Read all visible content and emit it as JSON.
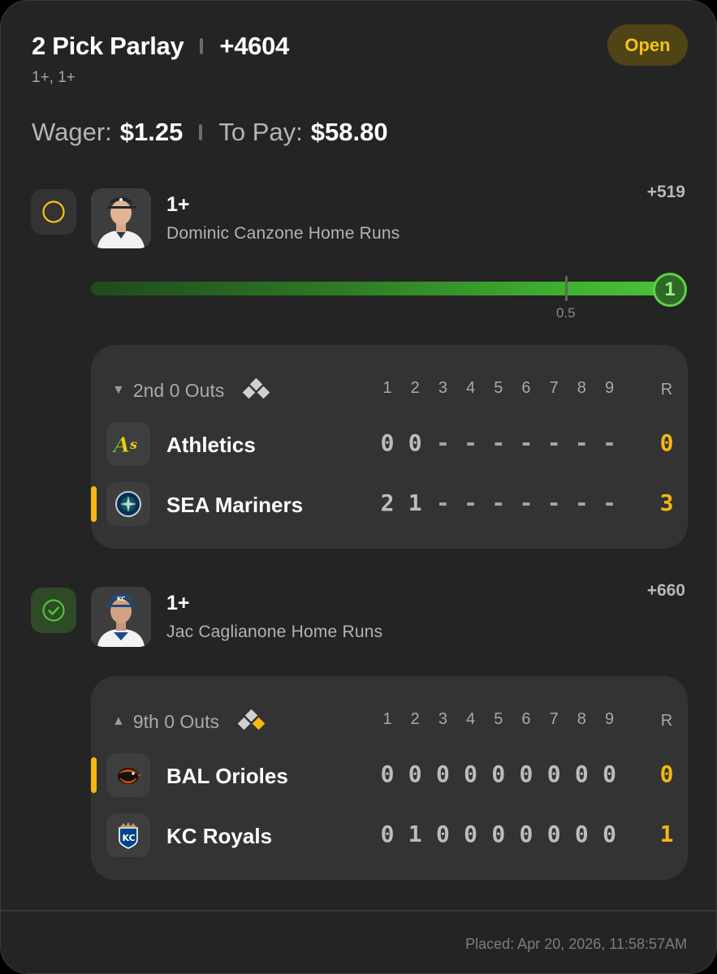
{
  "header": {
    "title": "2 Pick Parlay",
    "odds": "+4604",
    "subtitle": "1+, 1+",
    "status": "Open"
  },
  "wager": {
    "wager_label": "Wager:",
    "wager_value": "$1.25",
    "pay_label": "To Pay:",
    "pay_value": "$58.80"
  },
  "legs": [
    {
      "line": "1+",
      "desc": "Dominic Canzone Home Runs",
      "odds": "+519",
      "state": "open",
      "progress": {
        "current": "1",
        "threshold": "0.5",
        "fraction": 1.0
      },
      "game": {
        "inning": "2nd 0 Outs",
        "inning_arrow": "▼",
        "innings": [
          "1",
          "2",
          "3",
          "4",
          "5",
          "6",
          "7",
          "8",
          "9"
        ],
        "runs_header": "R",
        "teams": [
          {
            "name": "Athletics",
            "scores": [
              "0",
              "0",
              "-",
              "-",
              "-",
              "-",
              "-",
              "-",
              "-"
            ],
            "runs": "0",
            "batting": false
          },
          {
            "name": "SEA Mariners",
            "scores": [
              "2",
              "1",
              "-",
              "-",
              "-",
              "-",
              "-",
              "-",
              "-"
            ],
            "runs": "3",
            "batting": true
          }
        ]
      }
    },
    {
      "line": "1+",
      "desc": "Jac Caglianone Home Runs",
      "odds": "+660",
      "state": "won",
      "game": {
        "inning": "9th 0 Outs",
        "inning_arrow": "▲",
        "innings": [
          "1",
          "2",
          "3",
          "4",
          "5",
          "6",
          "7",
          "8",
          "9"
        ],
        "runs_header": "R",
        "teams": [
          {
            "name": "BAL Orioles",
            "scores": [
              "0",
              "0",
              "0",
              "0",
              "0",
              "0",
              "0",
              "0",
              "0"
            ],
            "runs": "0",
            "batting": true
          },
          {
            "name": "KC Royals",
            "scores": [
              "0",
              "1",
              "0",
              "0",
              "0",
              "0",
              "0",
              "0",
              "0"
            ],
            "runs": "1",
            "batting": false
          }
        ]
      }
    }
  ],
  "footer": {
    "placed": "Placed: Apr 20, 2026, 11:58:57AM"
  },
  "colors": {
    "accent": "#f6b810",
    "win": "#4cc43a",
    "background": "#242424"
  }
}
